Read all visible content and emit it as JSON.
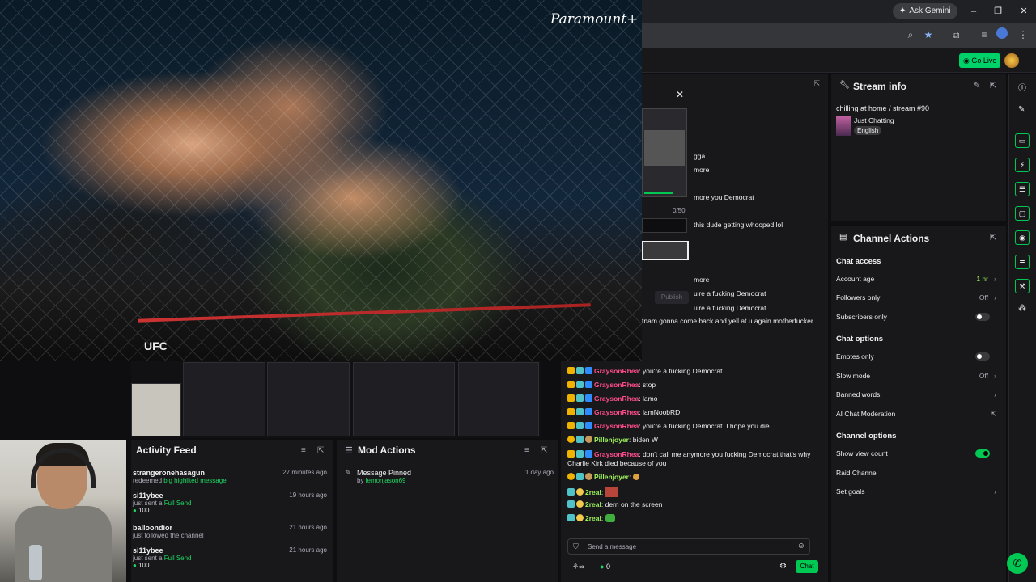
{
  "browser": {
    "gemini_label": "Ask Gemini"
  },
  "twitch_header": {
    "go_live": "Go Live"
  },
  "video": {
    "brand": "Paramount+",
    "ufc": "UFC"
  },
  "activity_feed": {
    "title": "Activity Feed",
    "items": [
      {
        "user": "strangeronehasagun",
        "action": "redeemed",
        "highlight": "big highlited message",
        "time": "27 minutes ago",
        "points": ""
      },
      {
        "user": "si11ybee",
        "action": "just sent a",
        "highlight": "Full Send",
        "time": "19 hours ago",
        "points": "100"
      },
      {
        "user": "balloondior",
        "action": "just followed the channel",
        "highlight": "",
        "time": "21 hours ago",
        "points": ""
      },
      {
        "user": "si11ybee",
        "action": "just sent a",
        "highlight": "Full Send",
        "time": "21 hours ago",
        "points": "100"
      }
    ]
  },
  "mod_actions": {
    "title": "Mod Actions",
    "items": [
      {
        "label": "Message Pinned",
        "by_prefix": "by",
        "by": "lemonjason69",
        "time": "1 day ago"
      }
    ]
  },
  "popout": {
    "counter": "0/50",
    "publish": "Publish",
    "fragments": [
      "gga",
      "more",
      "more you Democrat",
      "this dude getting whooped lol",
      "more",
      "u're a fucking Democrat",
      "u're a fucking Democrat",
      "tnam gonna come back and yell at u again motherfucker"
    ]
  },
  "chat": {
    "messages": [
      {
        "user": "GraysonRhea",
        "text": "you're a fucking Democrat",
        "color": "pink"
      },
      {
        "user": "GraysonRhea",
        "text": "stop",
        "color": "pink"
      },
      {
        "user": "GraysonRhea",
        "text": "lamo",
        "color": "pink"
      },
      {
        "user": "GraysonRhea",
        "text": "lamNoobRD",
        "color": "pink"
      },
      {
        "user": "GraysonRhea",
        "text": "you're a fucking Democrat. I hope you die.",
        "color": "pink"
      },
      {
        "user": "Pillenjoyer",
        "text": "biden W",
        "color": "green"
      },
      {
        "user": "GraysonRhea",
        "text": "don't call me anymore you fucking Democrat that's why Charlie Kirk died because of you",
        "color": "pink"
      },
      {
        "user": "Pillenjoyer",
        "text": "",
        "color": "green"
      },
      {
        "user": "2real",
        "text": "",
        "color": "green"
      },
      {
        "user": "2real",
        "text": "dern on the screen",
        "color": "green"
      },
      {
        "user": "2real",
        "text": "",
        "color": "green"
      }
    ],
    "input_placeholder": "Send a message",
    "points_count": "0",
    "chat_button": "Chat"
  },
  "stream_info": {
    "title": "Stream info",
    "stream_title": "chilling at home / stream #90",
    "category": "Just Chatting",
    "language": "English"
  },
  "channel_actions": {
    "title": "Channel Actions",
    "chat_access": "Chat access",
    "account_age": "Account age",
    "account_age_value": "1 hr",
    "followers_only": "Followers only",
    "followers_only_value": "Off",
    "subscribers_only": "Subscribers only",
    "chat_options": "Chat options",
    "emotes_only": "Emotes only",
    "slow_mode": "Slow mode",
    "slow_mode_value": "Off",
    "banned_words": "Banned words",
    "ai_moderation": "AI Chat Moderation",
    "channel_options": "Channel options",
    "show_view_count": "Show view count",
    "raid_channel": "Raid Channel",
    "set_goals": "Set goals"
  },
  "colors": {
    "accent": "#00c853",
    "chat_user_pink": "#ff4c8c",
    "chat_user_green": "#9df25a"
  }
}
